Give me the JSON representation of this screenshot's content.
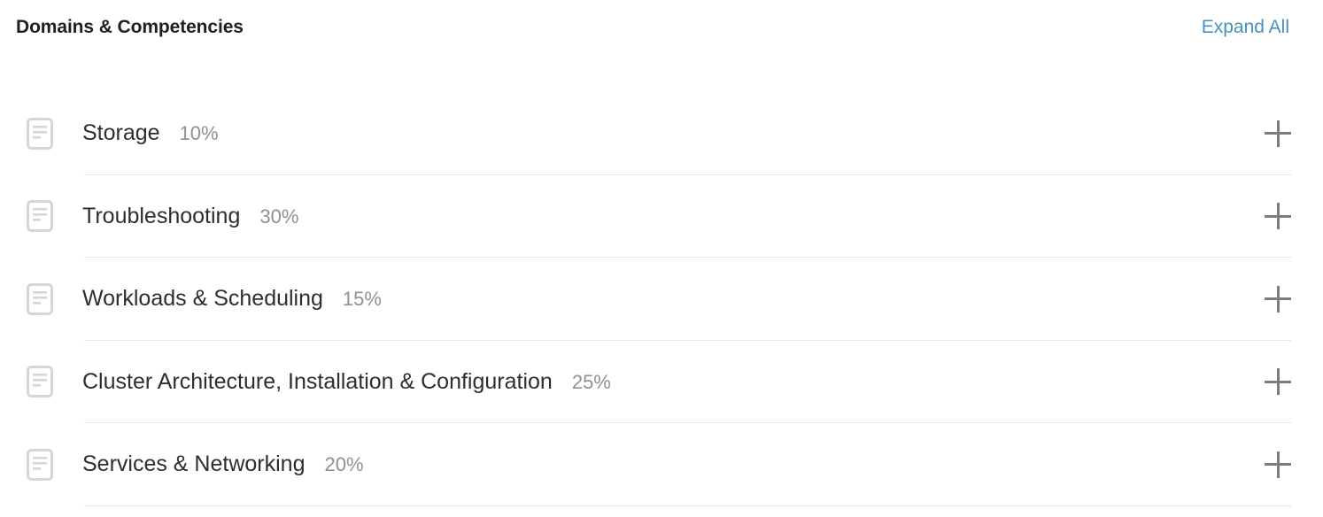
{
  "header": {
    "title": "Domains & Competencies",
    "expand_all_label": "Expand All",
    "link_color": "#4a90bf",
    "title_color": "#1f1f1f"
  },
  "colors": {
    "background": "#ffffff",
    "divider": "#e6e6e6",
    "label_text": "#2e2e2e",
    "percent_text": "#909090",
    "icon_gray": "#d6d6d6",
    "plus_gray": "#7d7d7d"
  },
  "list": {
    "row_icon": "document-icon",
    "toggle_icon": "plus-icon",
    "rows": [
      {
        "label": "Storage",
        "percent": "10%",
        "weight": 10
      },
      {
        "label": "Troubleshooting",
        "percent": "30%",
        "weight": 30
      },
      {
        "label": "Workloads & Scheduling",
        "percent": "15%",
        "weight": 15
      },
      {
        "label": "Cluster Architecture, Installation & Configuration",
        "percent": "25%",
        "weight": 25
      },
      {
        "label": "Services & Networking",
        "percent": "20%",
        "weight": 20
      }
    ]
  }
}
